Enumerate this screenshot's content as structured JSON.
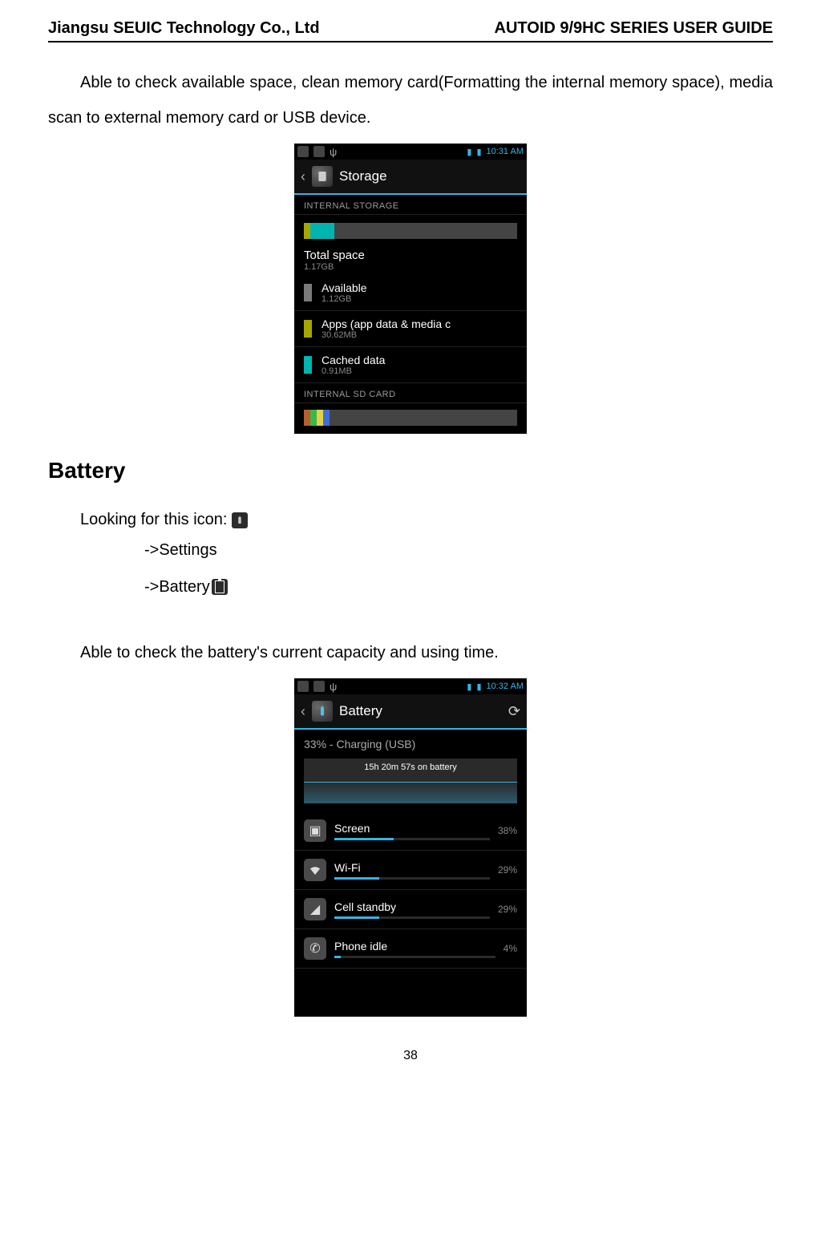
{
  "header": {
    "left": "Jiangsu SEUIC Technology Co., Ltd",
    "right": "AUTOID 9/9HC SERIES USER GUIDE"
  },
  "intro_text": "Able to check available space, clean memory card(Formatting the internal memory space), media scan to external memory card or USB device.",
  "storage_phone": {
    "time": "10:31 AM",
    "title": "Storage",
    "sections": {
      "internal_label": "INTERNAL STORAGE",
      "total": {
        "label": "Total space",
        "value": "1.17GB"
      },
      "rows": [
        {
          "label": "Available",
          "value": "1.12GB",
          "color": "#7a7a7a"
        },
        {
          "label": "Apps (app data & media c",
          "value": "30.62MB",
          "color": "#a6a600"
        },
        {
          "label": "Cached data",
          "value": "0.91MB",
          "color": "#00b5b0"
        }
      ],
      "sd_label": "INTERNAL SD CARD"
    }
  },
  "section_heading": "Battery",
  "looking_label": "Looking for this icon:",
  "nav_steps": {
    "settings": "->Settings",
    "battery": "->Battery"
  },
  "battery_desc": "Able to check the battery's current capacity and using time.",
  "battery_phone": {
    "time": "10:32 AM",
    "title": "Battery",
    "status_line": "33% - Charging (USB)",
    "graph_label": "15h 20m 57s on battery",
    "rows": [
      {
        "name": "Screen",
        "pct": "38%",
        "fill": 38
      },
      {
        "name": "Wi-Fi",
        "pct": "29%",
        "fill": 29
      },
      {
        "name": "Cell standby",
        "pct": "29%",
        "fill": 29
      },
      {
        "name": "Phone idle",
        "pct": "4%",
        "fill": 4
      }
    ]
  },
  "page_number": "38"
}
